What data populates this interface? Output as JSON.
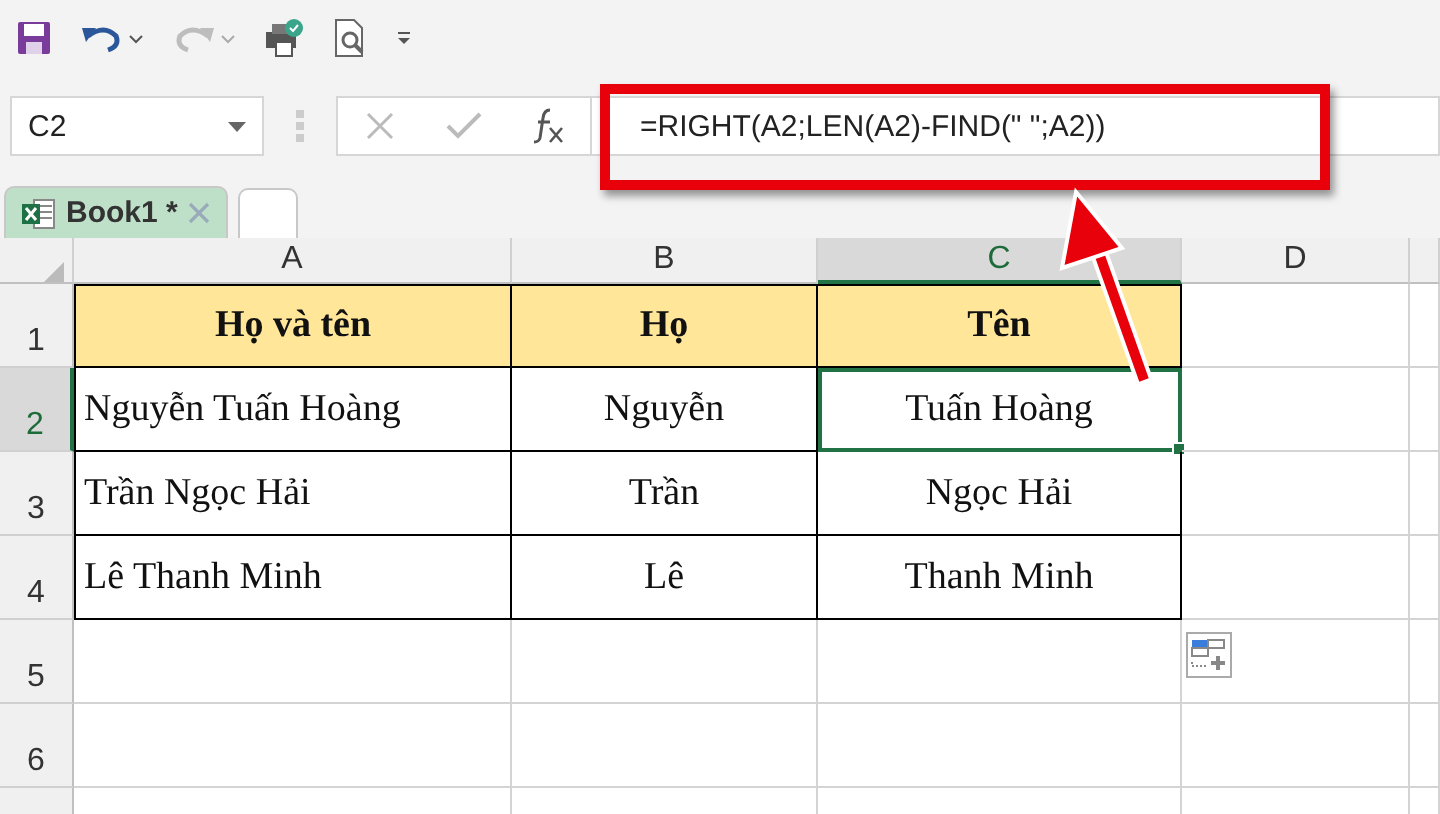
{
  "toolbar": {
    "redo_disabled": true
  },
  "name_box": {
    "value": "C2"
  },
  "formula_bar": {
    "value": "=RIGHT(A2;LEN(A2)-FIND(\" \";A2))"
  },
  "tabs": [
    {
      "label": "Book1 *",
      "selected": true
    }
  ],
  "columns": [
    {
      "label": "A",
      "selected": false
    },
    {
      "label": "B",
      "selected": false
    },
    {
      "label": "C",
      "selected": true
    },
    {
      "label": "D",
      "selected": false
    }
  ],
  "rows": [
    {
      "label": "1",
      "selected": false,
      "kind": "header",
      "cells": [
        {
          "text": "Họ và tên",
          "selected": false
        },
        {
          "text": "Họ",
          "selected": false
        },
        {
          "text": "Tên",
          "selected": false
        }
      ]
    },
    {
      "label": "2",
      "selected": true,
      "kind": "data",
      "cells": [
        {
          "text": "Nguyễn Tuấn Hoàng",
          "selected": false
        },
        {
          "text": "Nguyễn",
          "selected": false
        },
        {
          "text": "Tuấn Hoàng",
          "selected": true
        }
      ]
    },
    {
      "label": "3",
      "selected": false,
      "kind": "data",
      "cells": [
        {
          "text": "Trần Ngọc Hải",
          "selected": false
        },
        {
          "text": "Trần",
          "selected": false
        },
        {
          "text": "Ngọc Hải",
          "selected": false
        }
      ]
    },
    {
      "label": "4",
      "selected": false,
      "kind": "data",
      "cells": [
        {
          "text": "Lê Thanh Minh",
          "selected": false
        },
        {
          "text": "Lê",
          "selected": false
        },
        {
          "text": "Thanh Minh",
          "selected": false
        }
      ]
    },
    {
      "label": "5",
      "selected": false,
      "kind": "empty"
    },
    {
      "label": "6",
      "selected": false,
      "kind": "empty"
    }
  ]
}
